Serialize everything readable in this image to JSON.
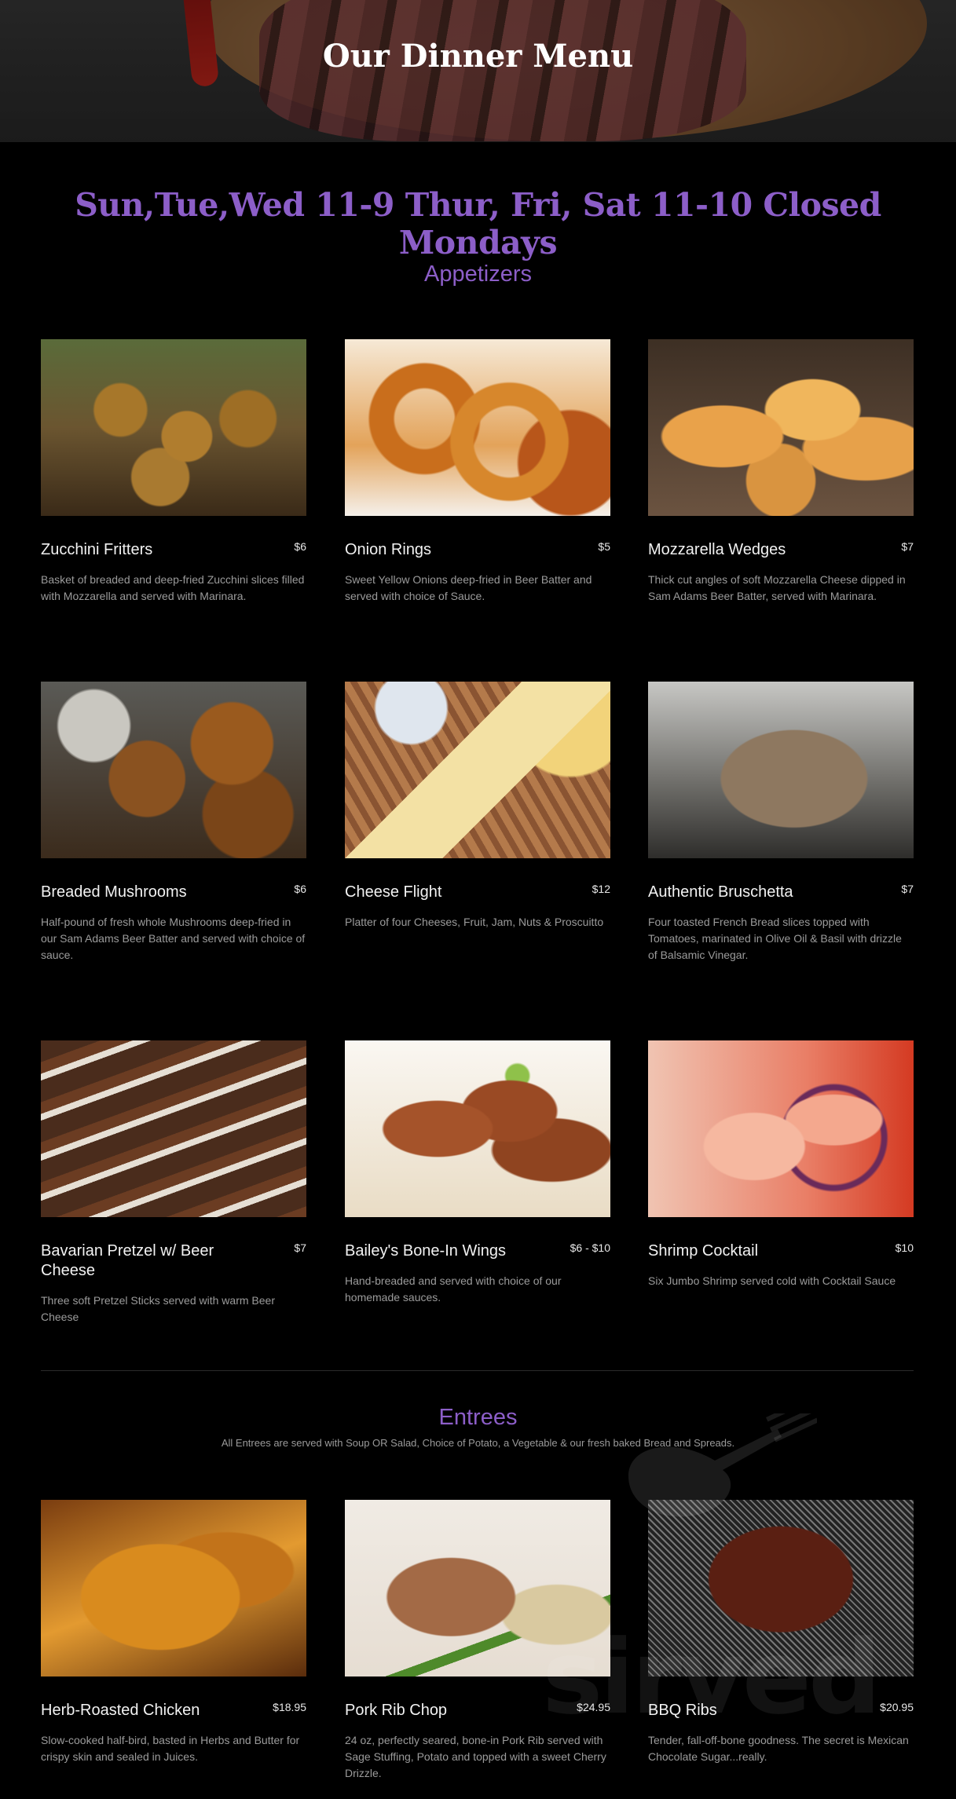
{
  "header": {
    "title": "Our Dinner Menu"
  },
  "hours_text": "Sun,Tue,Wed 11-9 Thur, Fri, Sat 11-10 Closed Mondays",
  "appetizers": {
    "title": "Appetizers",
    "items": [
      {
        "name": "Zucchini Fritters",
        "price": "$6",
        "description": "Basket of breaded and deep-fried Zucchini slices filled with Mozzarella and served with Marinara."
      },
      {
        "name": "Onion Rings",
        "price": "$5",
        "description": "Sweet Yellow Onions deep-fried in Beer Batter and served with choice of Sauce."
      },
      {
        "name": "Mozzarella Wedges",
        "price": "$7",
        "description": "Thick cut angles of soft Mozzarella Cheese dipped in Sam Adams Beer Batter, served with Marinara."
      },
      {
        "name": "Breaded Mushrooms",
        "price": "$6",
        "description": "Half-pound of fresh whole Mushrooms deep-fried in our Sam Adams Beer Batter and served with choice of sauce."
      },
      {
        "name": "Cheese Flight",
        "price": "$12",
        "description": "Platter of four Cheeses, Fruit, Jam, Nuts & Proscuitto"
      },
      {
        "name": "Authentic Bruschetta",
        "price": "$7",
        "description": "Four toasted French Bread slices topped with Tomatoes, marinated in Olive Oil & Basil with drizzle of Balsamic Vinegar."
      },
      {
        "name": "Bavarian Pretzel w/ Beer Cheese",
        "price": "$7",
        "description": "Three soft Pretzel Sticks served with warm Beer Cheese"
      },
      {
        "name": "Bailey's Bone-In Wings",
        "price": "$6 - $10",
        "description": "Hand-breaded and served with choice of our homemade sauces."
      },
      {
        "name": "Shrimp Cocktail",
        "price": "$10",
        "description": "Six Jumbo Shrimp served cold with Cocktail Sauce"
      }
    ]
  },
  "entrees": {
    "title": "Entrees",
    "note": "All Entrees are served with Soup OR Salad, Choice of Potato, a Vegetable & our fresh baked Bread and Spreads.",
    "items": [
      {
        "name": "Herb-Roasted Chicken",
        "price": "$18.95",
        "description": "Slow-cooked half-bird, basted in Herbs and Butter for crispy skin and sealed in Juices."
      },
      {
        "name": "Pork Rib Chop",
        "price": "$24.95",
        "description": "24 oz, perfectly seared, bone-in Pork Rib served with Sage Stuffing, Potato and topped with a sweet Cherry Drizzle."
      },
      {
        "name": "BBQ Ribs",
        "price": "$20.95",
        "description": "Tender, fall-off-bone goodness.  The secret is Mexican Chocolate Sugar...really."
      }
    ]
  },
  "watermark": {
    "text": "sirved"
  },
  "colors": {
    "accent": "#8c5ec8",
    "background": "#000000",
    "muted_text": "#9b9b9b"
  }
}
